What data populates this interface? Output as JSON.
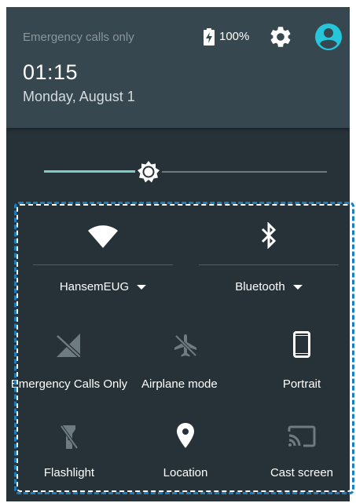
{
  "status": {
    "carrier": "Emergency calls only",
    "battery_percent": "100%",
    "time": "01:15",
    "date": "Monday, August 1"
  },
  "brightness": {
    "level": 0.37
  },
  "tiles": {
    "wifi": {
      "label": "HansemEUG",
      "icon": "wifi-icon"
    },
    "bluetooth": {
      "label": "Bluetooth",
      "icon": "bluetooth-icon"
    },
    "cellular": {
      "label": "Emergency Calls Only",
      "icon": "no-signal-icon"
    },
    "airplane": {
      "label": "Airplane mode",
      "icon": "airplane-icon"
    },
    "rotation": {
      "label": "Portrait",
      "icon": "portrait-icon"
    },
    "flashlight": {
      "label": "Flashlight",
      "icon": "flashlight-icon"
    },
    "location": {
      "label": "Location",
      "icon": "location-icon"
    },
    "cast": {
      "label": "Cast screen",
      "icon": "cast-icon"
    }
  },
  "colors": {
    "panel": "#263238",
    "header": "#37474f",
    "accent": "#80cbc4",
    "avatar": "#26c6da",
    "inactive_icon": "#6e7b80",
    "highlight_border": "#1a7fbf"
  }
}
